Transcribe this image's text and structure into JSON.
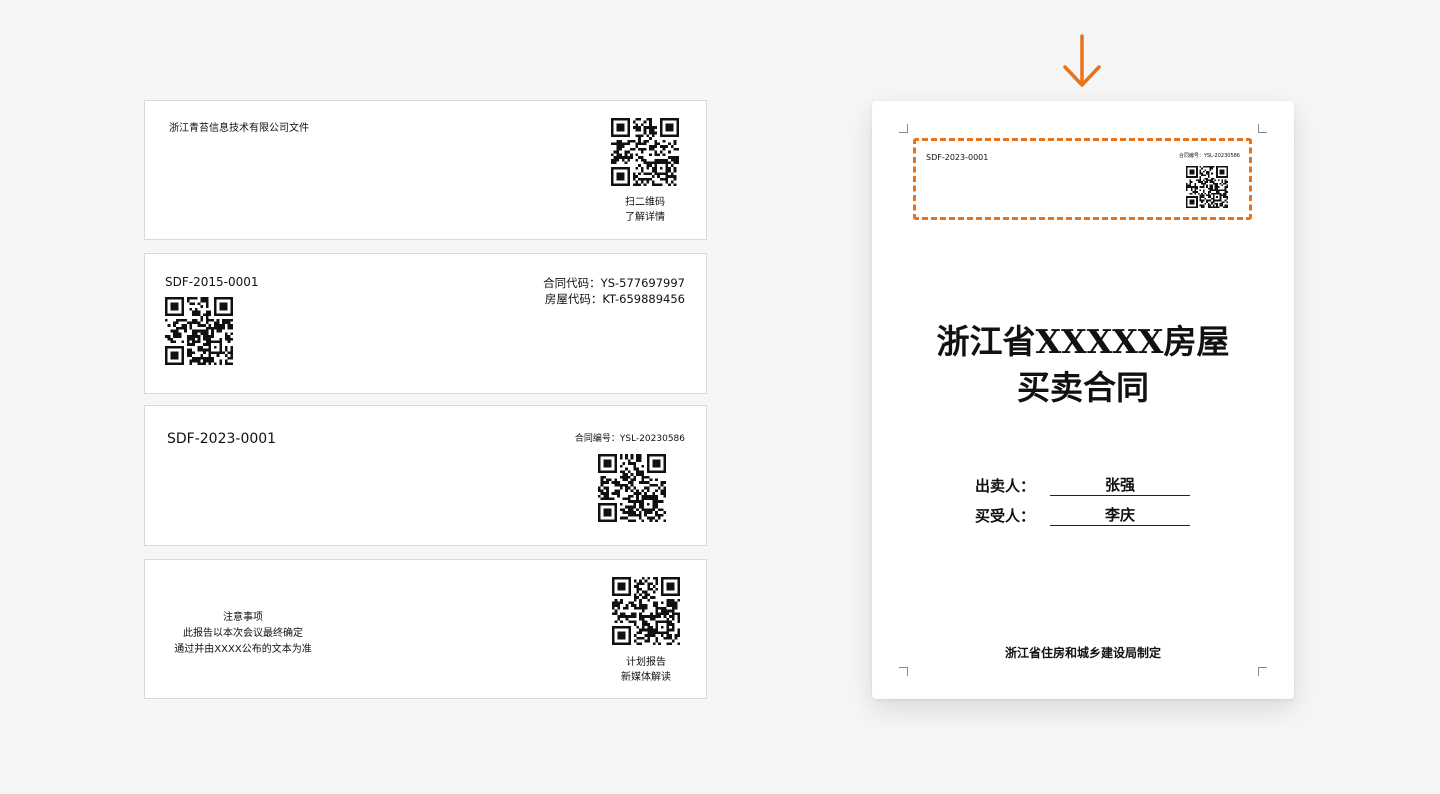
{
  "card1": {
    "company_title": "浙江青苔信息技术有限公司文件",
    "qr_caption_line1": "扫二维码",
    "qr_caption_line2": "了解详情"
  },
  "card2": {
    "doc_id": "SDF-2015-0001",
    "contract_code": "合同代码：YS-577697997",
    "house_code": "房屋代码：KT-659889456"
  },
  "card3": {
    "doc_id": "SDF-2023-0001",
    "contract_no": "合同编号：YSL-20230586"
  },
  "card4": {
    "notice_title": "注意事项",
    "notice_line1": "此报告以本次会议最终确定",
    "notice_line2": "通过并由XXXX公布的文本为准",
    "qr_caption_line1": "计划报告",
    "qr_caption_line2": "新媒体解读"
  },
  "preview": {
    "header_doc_id": "SDF-2023-0001",
    "header_contract_no": "合同编号：YSL-20230586",
    "title_line1": "浙江省XXXXX房屋",
    "title_line2": "买卖合同",
    "seller_label": "出卖人：",
    "seller_name": "张强",
    "buyer_label": "买受人：",
    "buyer_name": "李庆",
    "issuer": "浙江省住房和城乡建设局制定"
  },
  "colors": {
    "accent": "#e8731a",
    "background": "#f6f6f6"
  },
  "icons": {
    "arrow": "arrow-down-icon",
    "qr": "qr-code-icon"
  }
}
